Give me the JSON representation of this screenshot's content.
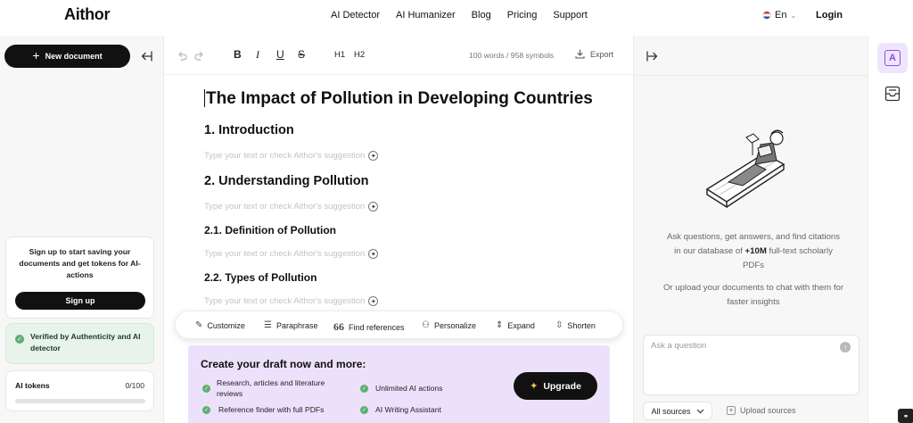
{
  "header": {
    "logo": "Aithor",
    "nav": [
      "AI Detector",
      "AI Humanizer",
      "Blog",
      "Pricing",
      "Support"
    ],
    "language": "En",
    "login": "Login"
  },
  "sidebar": {
    "new_document": "New document",
    "signup_prompt": "Sign up to start saving your documents and get tokens for AI-actions",
    "signup_button": "Sign up",
    "verified": "Verified by Authenticity and AI detector",
    "tokens_label": "AI tokens",
    "tokens_value": "0/100",
    "tokens_used_fraction": 0
  },
  "toolbar": {
    "bold": "B",
    "italic": "I",
    "underline": "U",
    "strike": "S",
    "h1": "H1",
    "h2": "H2",
    "word_count": "100 words / 958 symbols",
    "export": "Export"
  },
  "document": {
    "title": "The Impact of Pollution in Developing Countries",
    "placeholder": "Type your text or check Aithor's suggestion",
    "sections": [
      {
        "heading": "1. Introduction",
        "level": 2
      },
      {
        "heading": "2. Understanding Pollution",
        "level": 2
      },
      {
        "heading": "2.1. Definition of Pollution",
        "level": 3
      },
      {
        "heading": "2.2. Types of Pollution",
        "level": 3
      }
    ]
  },
  "actions": [
    "Customize",
    "Paraphrase",
    "Find references",
    "Personalize",
    "Expand",
    "Shorten"
  ],
  "upgrade": {
    "title": "Create your draft now and more:",
    "features": [
      "Research, articles and literature reviews",
      "Unlimited AI actions",
      "Reference finder with full PDFs",
      "AI Writing Assistant"
    ],
    "button": "Upgrade"
  },
  "chat": {
    "intro_pre": "Ask questions, get answers, and find citations in our database of ",
    "intro_bold": "+10M",
    "intro_post": " full-text scholarly PDFs",
    "upload_hint": "Or upload your documents to chat with them for faster insights",
    "input_placeholder": "Ask a question",
    "sources": "All sources",
    "upload_sources": "Upload sources"
  }
}
